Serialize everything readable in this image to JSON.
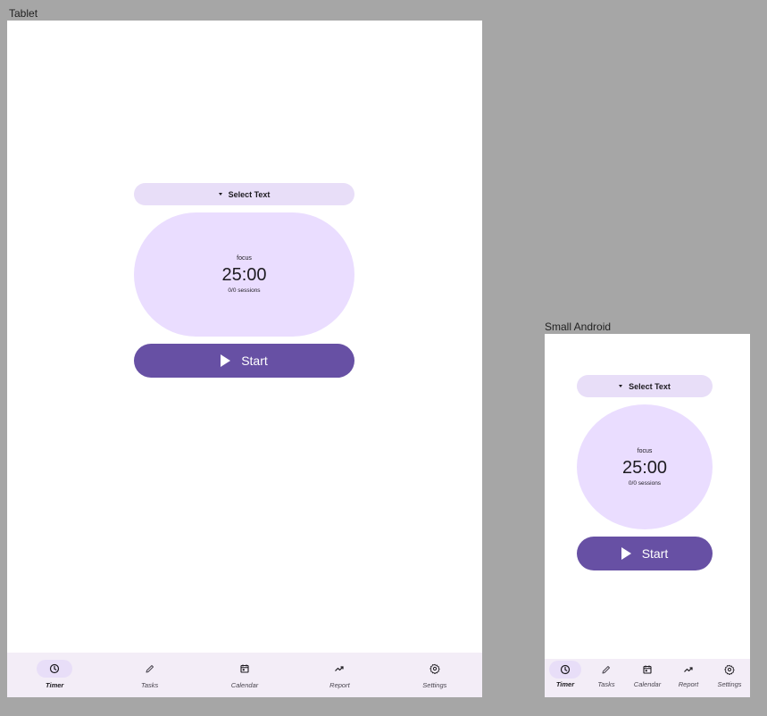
{
  "frames": {
    "tablet": {
      "label": "Tablet",
      "dropdown_label": "Select Text",
      "timer_mode": "focus",
      "timer_time": "25:00",
      "timer_sessions": "0/0 sessions",
      "start_label": "Start",
      "nav": [
        {
          "label": "Timer",
          "icon": "clock-icon",
          "active": true
        },
        {
          "label": "Tasks",
          "icon": "pencil-icon",
          "active": false
        },
        {
          "label": "Calendar",
          "icon": "calendar-icon",
          "active": false
        },
        {
          "label": "Report",
          "icon": "trend-icon",
          "active": false
        },
        {
          "label": "Settings",
          "icon": "gear-icon",
          "active": false
        }
      ]
    },
    "small_android": {
      "label": "Small Android",
      "dropdown_label": "Select Text",
      "timer_mode": "focus",
      "timer_time": "25:00",
      "timer_sessions": "0/0 sessions",
      "start_label": "Start",
      "nav": [
        {
          "label": "Timer",
          "icon": "clock-icon",
          "active": true
        },
        {
          "label": "Tasks",
          "icon": "pencil-icon",
          "active": false
        },
        {
          "label": "Calendar",
          "icon": "calendar-icon",
          "active": false
        },
        {
          "label": "Report",
          "icon": "trend-icon",
          "active": false
        },
        {
          "label": "Settings",
          "icon": "gear-icon",
          "active": false
        }
      ]
    }
  },
  "colors": {
    "canvas": "#a6a6a6",
    "primary": "#6750a4",
    "primary_container": "#eaddff",
    "secondary_container": "#e8def8",
    "nav_surface": "#f3edf7"
  }
}
